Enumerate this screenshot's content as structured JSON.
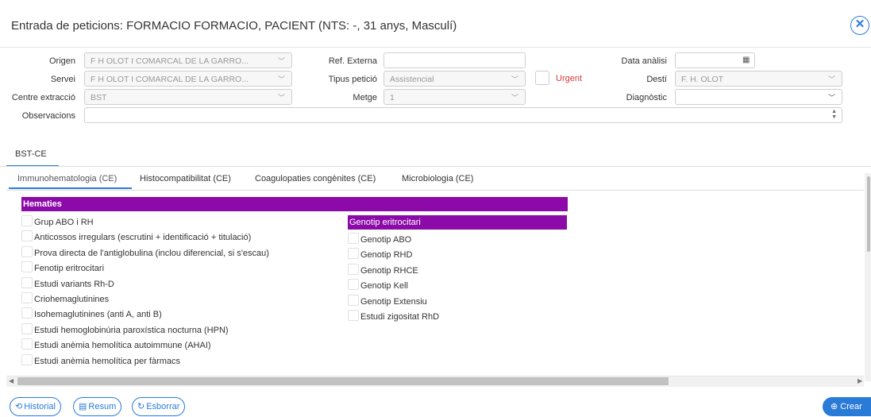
{
  "window": {
    "title": "Entrada de peticions: FORMACIO FORMACIO, PACIENT (NTS: -, 31 anys, Masculí)"
  },
  "form": {
    "origen": {
      "label": "Origen",
      "value": "F H OLOT I COMARCAL DE LA GARRO..."
    },
    "servei": {
      "label": "Servei",
      "value": "F H OLOT I COMARCAL DE LA GARRO..."
    },
    "centre_extraccio": {
      "label": "Centre extracció",
      "value": "BST"
    },
    "observacions": {
      "label": "Observacions",
      "value": ""
    },
    "ref_externa": {
      "label": "Ref. Externa",
      "value": ""
    },
    "tipus_peticio": {
      "label": "Tipus petició",
      "value": "Assistencial"
    },
    "metge": {
      "label": "Metge",
      "value": "1"
    },
    "urgent": {
      "label": "Urgent"
    },
    "data_analisi": {
      "label": "Data anàlisi",
      "value": ""
    },
    "desti": {
      "label": "Destí",
      "value": "F. H. OLOT"
    },
    "diagnostic": {
      "label": "Diagnòstic",
      "value": ""
    }
  },
  "section_tab": {
    "label": "BST-CE"
  },
  "subtabs": [
    {
      "label": "Immunohematologia (CE)"
    },
    {
      "label": "Histocompatibilitat (CE)"
    },
    {
      "label": "Coagulopaties congènites (CE)"
    },
    {
      "label": "Microbiologia (CE)"
    }
  ],
  "hematies": {
    "header": "Hematies",
    "items": [
      "Grup ABO i RH",
      "Anticossos irregulars (escrutini + identificació + titulació)",
      "Prova directa de l'antiglobulina (inclou diferencial, si s'escau)",
      "Fenotip eritrocitari",
      "Estudi variants Rh-D",
      "Criohemaglutinines",
      "Isohemaglutinines (anti A, anti B)",
      "Estudi hemoglobinúria paroxística nocturna (HPN)",
      "Estudi anèmia hemolítica autoimmune (AHAI)",
      "Estudi anèmia hemolítica per fàrmacs"
    ]
  },
  "genotip": {
    "header": "Genotip eritrocitari",
    "items": [
      "Genotip ABO",
      "Genotip RHD",
      "Genotip RHCE",
      "Genotip Kell",
      "Genotip Extensiu",
      "Estudi zigositat RhD"
    ]
  },
  "footer": {
    "historial": "Historial",
    "resum": "Resum",
    "esborrar": "Esborrar",
    "crear": "Crear"
  },
  "colors": {
    "accent": "#2a7bd8",
    "header_purple": "#8b0aa8",
    "urgent_red": "#d43a3a"
  },
  "icons": [
    "close-icon",
    "calendar-icon",
    "chevron-down-icon",
    "history-icon",
    "list-icon",
    "refresh-icon",
    "plus-circle-icon"
  ]
}
